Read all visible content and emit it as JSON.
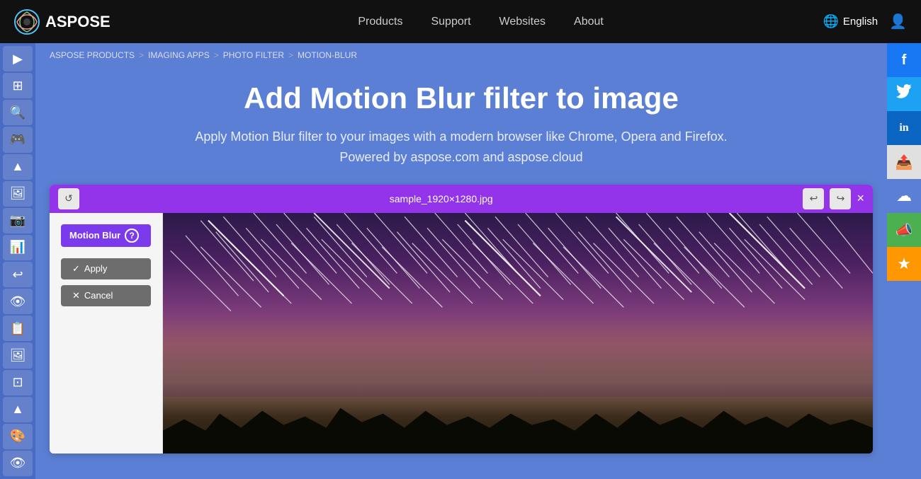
{
  "brand": {
    "name": "ASPOSE",
    "logo_alt": "Aspose logo"
  },
  "nav": {
    "links": [
      {
        "label": "Products",
        "key": "products"
      },
      {
        "label": "Support",
        "key": "support"
      },
      {
        "label": "Websites",
        "key": "websites"
      },
      {
        "label": "About",
        "key": "about"
      }
    ],
    "language": "English",
    "user_icon": "👤"
  },
  "breadcrumb": {
    "items": [
      "ASPOSE PRODUCTS",
      "IMAGING APPS",
      "PHOTO FILTER",
      "MOTION-BLUR"
    ],
    "separators": [
      ">",
      ">",
      ">"
    ]
  },
  "hero": {
    "title": "Add Motion Blur filter to image",
    "subtitle": "Apply Motion Blur filter to your images with a modern browser like Chrome, Opera and Firefox.",
    "powered_by": "Powered by aspose.com and aspose.cloud"
  },
  "tool": {
    "filter_label": "Motion Blur",
    "help_icon": "?",
    "filename": "sample_1920×1280.jpg",
    "close_label": "×",
    "apply_label": "Apply",
    "cancel_label": "Cancel",
    "apply_icon": "✓",
    "cancel_icon": "✕"
  },
  "sidebar": {
    "icons": [
      "▶",
      "⊞",
      "🔍",
      "🎮",
      "🏔",
      "🖼",
      "📷",
      "📊",
      "↩",
      "👁",
      "📋",
      "🖼",
      "⊡",
      "🏔",
      "🎨",
      "👁"
    ]
  },
  "social": {
    "links": [
      {
        "name": "facebook",
        "icon": "f",
        "color": "#1877f2"
      },
      {
        "name": "twitter",
        "icon": "🐦",
        "color": "#1da1f2"
      },
      {
        "name": "linkedin",
        "icon": "in",
        "color": "#0a66c2"
      },
      {
        "name": "share",
        "icon": "📤",
        "color": "#e0e0e0"
      },
      {
        "name": "cloud",
        "icon": "☁",
        "color": "#5b7fd4"
      },
      {
        "name": "megaphone",
        "icon": "📣",
        "color": "#4caf50"
      },
      {
        "name": "star",
        "icon": "★",
        "color": "#ff9800"
      }
    ]
  }
}
